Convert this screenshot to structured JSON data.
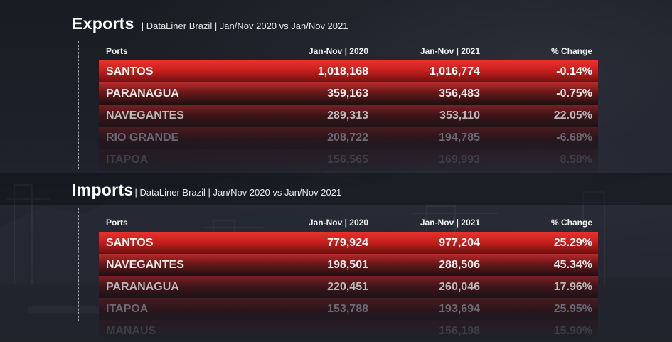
{
  "exports": {
    "title": "Exports",
    "subtitle": "|  DataLiner Brazil | Jan/Nov 2020 vs Jan/Nov 2021",
    "headers": {
      "port": "Ports",
      "y2020": "Jan-Nov | 2020",
      "y2021": "Jan-Nov | 2021",
      "change": "% Change"
    },
    "rows": [
      {
        "port": "SANTOS",
        "y2020": "1,018,168",
        "y2021": "1,016,774",
        "change": "-0.14%"
      },
      {
        "port": "PARANAGUA",
        "y2020": "359,163",
        "y2021": "356,483",
        "change": "-0.75%"
      },
      {
        "port": "NAVEGANTES",
        "y2020": "289,313",
        "y2021": "353,110",
        "change": "22.05%"
      },
      {
        "port": "RIO GRANDE",
        "y2020": "208,722",
        "y2021": "194,785",
        "change": "-6.68%"
      },
      {
        "port": "ITAPOA",
        "y2020": "156,565",
        "y2021": "169,993",
        "change": "8.58%"
      }
    ]
  },
  "imports": {
    "title": "Imports",
    "subtitle": "| DataLiner Brazil | Jan/Nov 2020 vs Jan/Nov 2021",
    "headers": {
      "port": "Ports",
      "y2020": "Jan-Nov | 2020",
      "y2021": "Jan-Nov | 2021",
      "change": "% Change"
    },
    "rows": [
      {
        "port": "SANTOS",
        "y2020": "779,924",
        "y2021": "977,204",
        "change": "25.29%"
      },
      {
        "port": "NAVEGANTES",
        "y2020": "198,501",
        "y2021": "288,506",
        "change": "45.34%"
      },
      {
        "port": "PARANAGUA",
        "y2020": "220,451",
        "y2021": "260,046",
        "change": "17.96%"
      },
      {
        "port": "ITAPOA",
        "y2020": "153,788",
        "y2021": "193,694",
        "change": "25.95%"
      },
      {
        "port": "MANAUS",
        "y2020": "",
        "y2021": "156,198",
        "change": "15.90%"
      }
    ]
  },
  "colors": {
    "accent_red": "#e8322e",
    "background": "#15171d"
  }
}
